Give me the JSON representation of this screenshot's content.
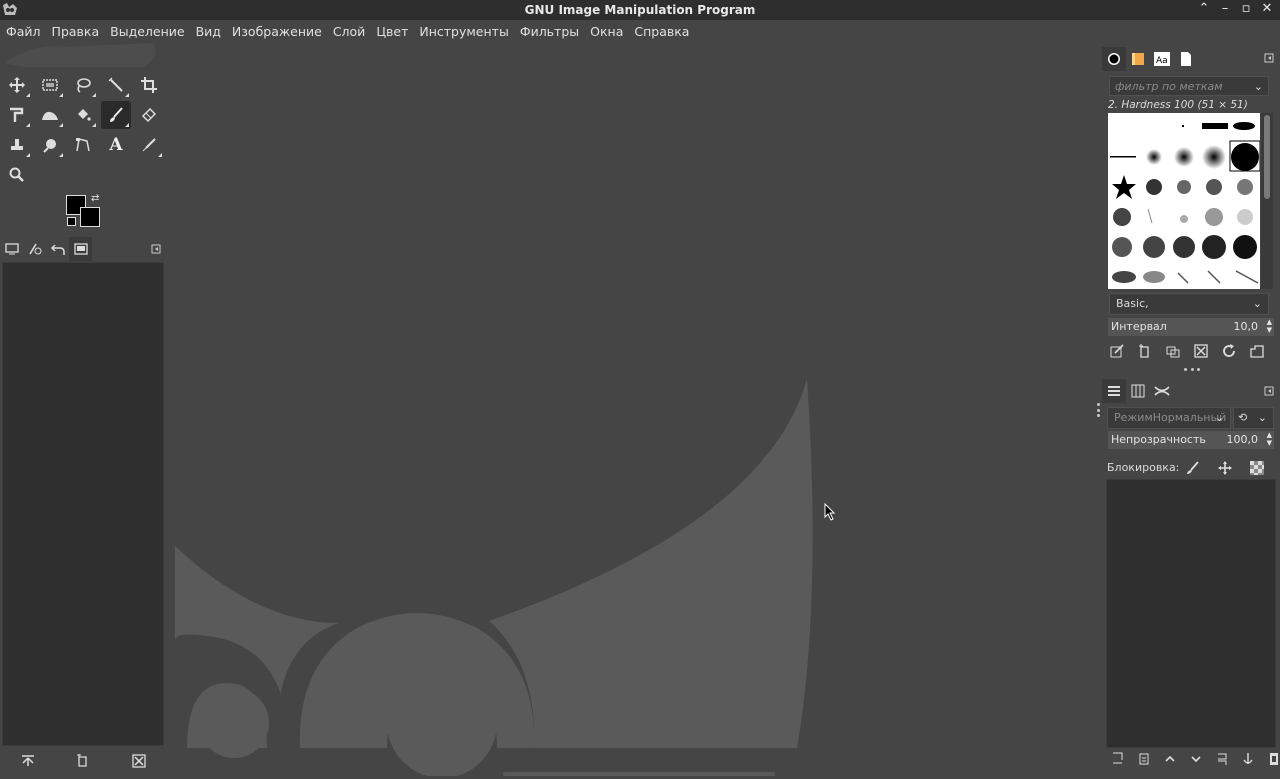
{
  "window": {
    "title": "GNU Image Manipulation Program"
  },
  "menu": [
    "Файл",
    "Правка",
    "Выделение",
    "Вид",
    "Изображение",
    "Слой",
    "Цвет",
    "Инструменты",
    "Фильтры",
    "Окна",
    "Справка"
  ],
  "tools": [
    {
      "name": "move-tool-icon"
    },
    {
      "name": "rect-select-icon"
    },
    {
      "name": "lasso-icon"
    },
    {
      "name": "fuzzy-select-icon"
    },
    {
      "name": "crop-icon"
    },
    {
      "name": "transform-icon"
    },
    {
      "name": "warp-icon"
    },
    {
      "name": "bucket-fill-icon"
    },
    {
      "name": "paintbrush-icon",
      "active": true
    },
    {
      "name": "eraser-icon"
    },
    {
      "name": "clone-icon"
    },
    {
      "name": "smudge-icon"
    },
    {
      "name": "paths-icon"
    },
    {
      "name": "text-icon",
      "glyph": "A"
    },
    {
      "name": "color-picker-icon"
    },
    {
      "name": "zoom-icon"
    }
  ],
  "brushes": {
    "filter_placeholder": "фильтр по меткам",
    "selected_name": "2. Hardness 100 (51 × 51)",
    "preset": "Basic,",
    "spacing_label": "Интервал",
    "spacing_value": "10,0"
  },
  "layers": {
    "mode_label": "Режим",
    "mode_value": "Нормальный",
    "opacity_label": "Непрозрачность",
    "opacity_value": "100,0",
    "lock_label": "Блокировка:"
  },
  "colors": {
    "foreground": "#000000",
    "background": "#000000",
    "panel_bg": "#454545",
    "wilber": "#5a5a5a"
  }
}
